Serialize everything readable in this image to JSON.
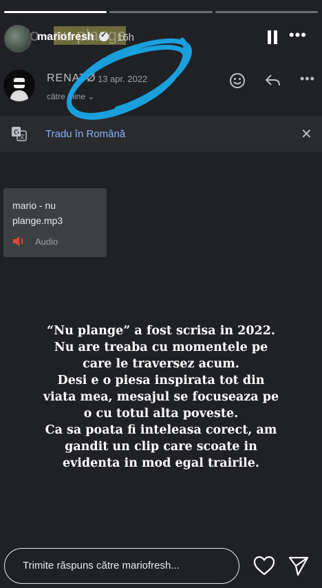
{
  "story": {
    "progress": [
      1,
      0,
      0
    ],
    "background_title": "rio - nu plange",
    "background_title_plain": "rio - ",
    "background_title_highlight": "nu plange",
    "username": "mariofresh",
    "time": "16h",
    "icons": {
      "verified": "verified-badge-icon",
      "pause": "pause-icon",
      "more": "more-horizontal-icon"
    }
  },
  "email": {
    "sender": "RENATØ",
    "date": "13 apr. 2022",
    "recipient": "către mine ⌄",
    "icons": {
      "emoji": "emoji-icon",
      "reply": "reply-icon",
      "more": "more-horizontal-icon"
    }
  },
  "translate": {
    "label": "Tradu în Română",
    "icons": {
      "translate": "translate-icon",
      "close": "close-icon"
    }
  },
  "attachment": {
    "name": "mario - nu plange.mp3",
    "type": "Audio",
    "icon": "speaker-icon"
  },
  "statement": [
    "“Nu plange” a fost scrisa in 2022.",
    "Nu are treaba cu momentele pe",
    "care le traversez acum.",
    "Desi e o piesa inspirata tot din",
    "viata mea, mesajul se focuseaza pe",
    "o cu totul alta poveste.",
    "Ca sa poata fi inteleasa corect, am",
    "gandit un clip care scoate in",
    "evidenta in mod egal trairile."
  ],
  "reply": {
    "placeholder": "Trimite răspuns către mariofresh...",
    "icons": {
      "heart": "heart-icon",
      "send": "send-icon"
    }
  },
  "colors": {
    "background": "#202124",
    "link": "#8ab4f8",
    "scribble": "#1aa6e8",
    "speaker": "#ea4335"
  }
}
